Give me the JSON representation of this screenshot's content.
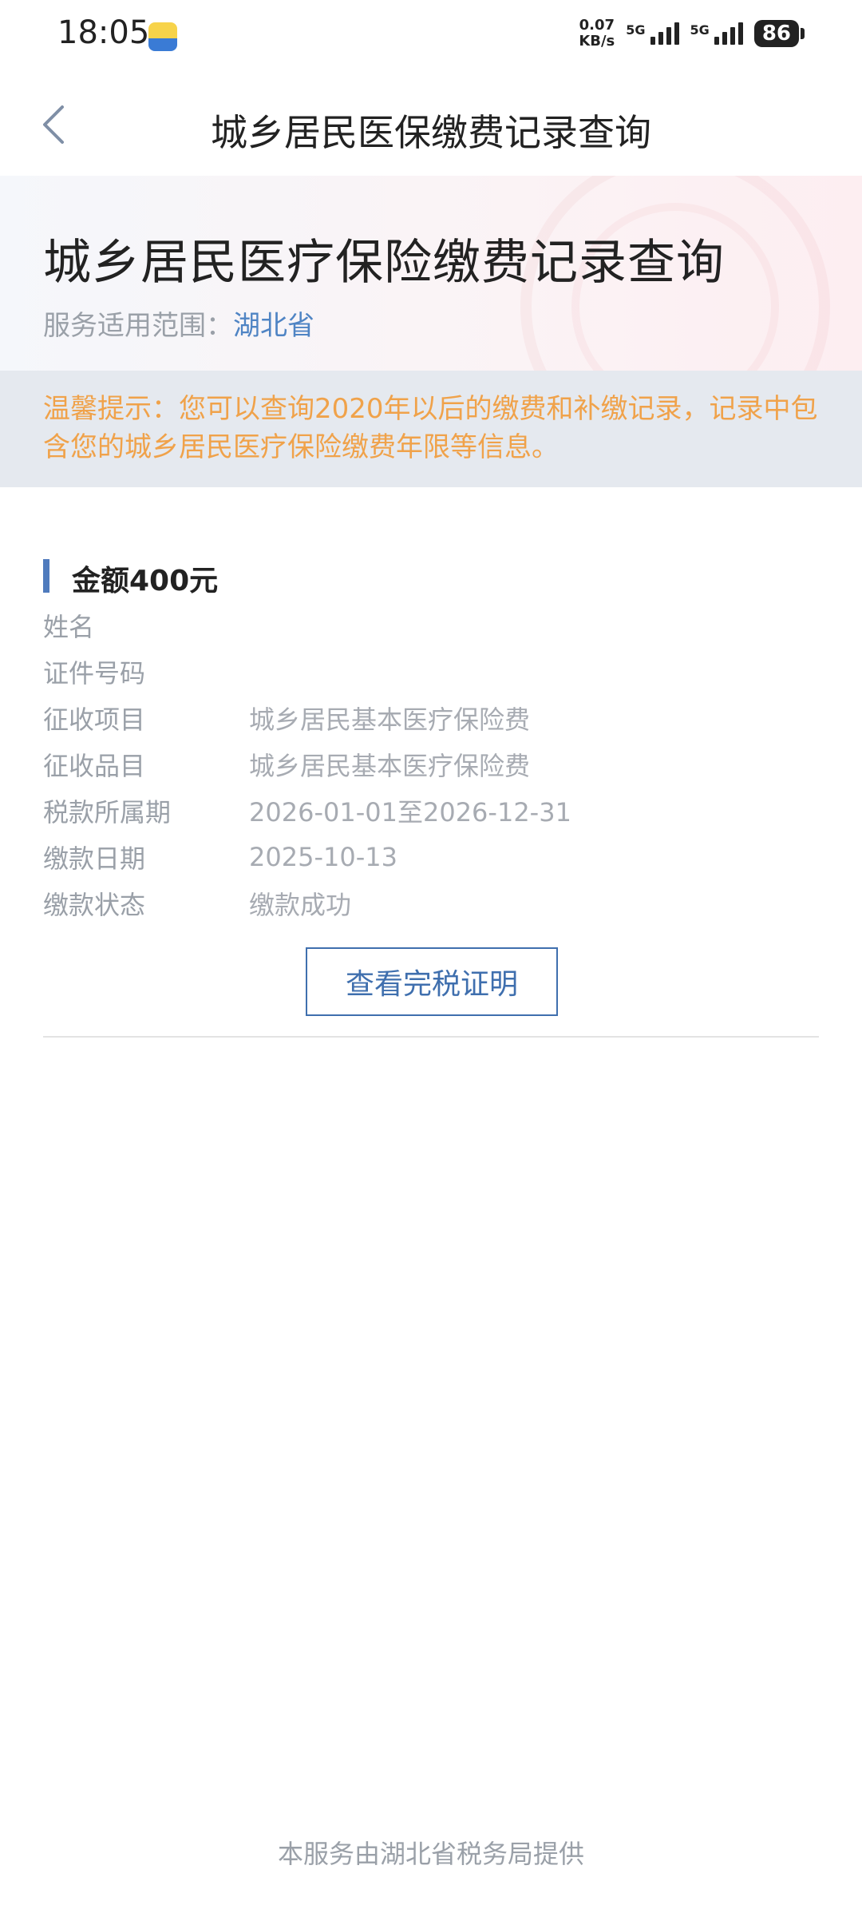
{
  "status_bar": {
    "time": "18:05",
    "net_speed_value": "0.07",
    "net_speed_unit": "KB/s",
    "network_1": "5G",
    "network_2": "5G",
    "battery": "86"
  },
  "navbar": {
    "title": "城乡居民医保缴费记录查询",
    "back_icon": "chevron-left-icon"
  },
  "banner": {
    "title": "城乡居民医疗保险缴费记录查询",
    "scope_label": "服务适用范围：",
    "scope_value": "湖北省"
  },
  "tip": {
    "text": "温馨提示：您可以查询2020年以后的缴费和补缴记录，记录中包含您的城乡居民医疗保险缴费年限等信息。"
  },
  "record": {
    "amount": "金额400元",
    "rows": [
      {
        "label": "姓名",
        "value": ""
      },
      {
        "label": "证件号码",
        "value": ""
      },
      {
        "label": "征收项目",
        "value": "城乡居民基本医疗保险费"
      },
      {
        "label": "征收品目",
        "value": "城乡居民基本医疗保险费"
      },
      {
        "label": "税款所属期",
        "value": "2026-01-01至2026-12-31"
      },
      {
        "label": "缴款日期",
        "value": "2025-10-13"
      },
      {
        "label": "缴款状态",
        "value": "缴款成功"
      }
    ],
    "certificate_button": "查看完税证明"
  },
  "footer": {
    "text": "本服务由湖北省税务局提供"
  },
  "colors": {
    "accent": "#3f6fae",
    "tip_text": "#f0a24a",
    "tip_bg": "#e5e9ef"
  }
}
